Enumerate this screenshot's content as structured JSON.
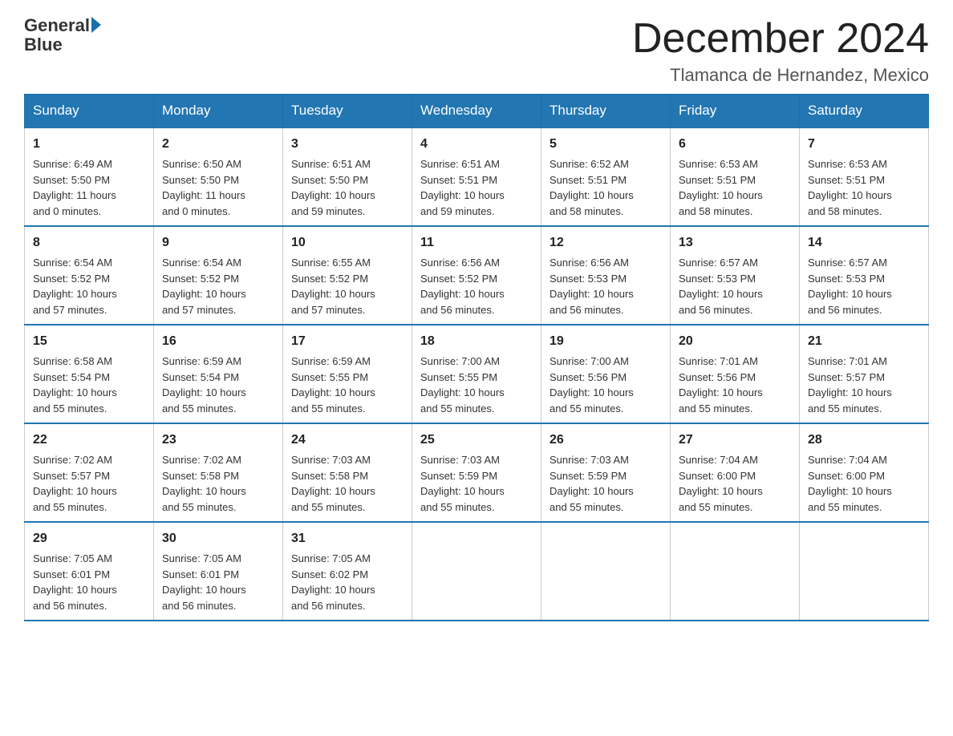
{
  "header": {
    "logo_general": "General",
    "logo_blue": "Blue",
    "month_title": "December 2024",
    "location": "Tlamanca de Hernandez, Mexico"
  },
  "days_of_week": [
    "Sunday",
    "Monday",
    "Tuesday",
    "Wednesday",
    "Thursday",
    "Friday",
    "Saturday"
  ],
  "weeks": [
    [
      {
        "day": "1",
        "sunrise": "6:49 AM",
        "sunset": "5:50 PM",
        "daylight_hours": "11",
        "daylight_minutes": "0"
      },
      {
        "day": "2",
        "sunrise": "6:50 AM",
        "sunset": "5:50 PM",
        "daylight_hours": "11",
        "daylight_minutes": "0"
      },
      {
        "day": "3",
        "sunrise": "6:51 AM",
        "sunset": "5:50 PM",
        "daylight_hours": "10",
        "daylight_minutes": "59"
      },
      {
        "day": "4",
        "sunrise": "6:51 AM",
        "sunset": "5:51 PM",
        "daylight_hours": "10",
        "daylight_minutes": "59"
      },
      {
        "day": "5",
        "sunrise": "6:52 AM",
        "sunset": "5:51 PM",
        "daylight_hours": "10",
        "daylight_minutes": "58"
      },
      {
        "day": "6",
        "sunrise": "6:53 AM",
        "sunset": "5:51 PM",
        "daylight_hours": "10",
        "daylight_minutes": "58"
      },
      {
        "day": "7",
        "sunrise": "6:53 AM",
        "sunset": "5:51 PM",
        "daylight_hours": "10",
        "daylight_minutes": "58"
      }
    ],
    [
      {
        "day": "8",
        "sunrise": "6:54 AM",
        "sunset": "5:52 PM",
        "daylight_hours": "10",
        "daylight_minutes": "57"
      },
      {
        "day": "9",
        "sunrise": "6:54 AM",
        "sunset": "5:52 PM",
        "daylight_hours": "10",
        "daylight_minutes": "57"
      },
      {
        "day": "10",
        "sunrise": "6:55 AM",
        "sunset": "5:52 PM",
        "daylight_hours": "10",
        "daylight_minutes": "57"
      },
      {
        "day": "11",
        "sunrise": "6:56 AM",
        "sunset": "5:52 PM",
        "daylight_hours": "10",
        "daylight_minutes": "56"
      },
      {
        "day": "12",
        "sunrise": "6:56 AM",
        "sunset": "5:53 PM",
        "daylight_hours": "10",
        "daylight_minutes": "56"
      },
      {
        "day": "13",
        "sunrise": "6:57 AM",
        "sunset": "5:53 PM",
        "daylight_hours": "10",
        "daylight_minutes": "56"
      },
      {
        "day": "14",
        "sunrise": "6:57 AM",
        "sunset": "5:53 PM",
        "daylight_hours": "10",
        "daylight_minutes": "56"
      }
    ],
    [
      {
        "day": "15",
        "sunrise": "6:58 AM",
        "sunset": "5:54 PM",
        "daylight_hours": "10",
        "daylight_minutes": "55"
      },
      {
        "day": "16",
        "sunrise": "6:59 AM",
        "sunset": "5:54 PM",
        "daylight_hours": "10",
        "daylight_minutes": "55"
      },
      {
        "day": "17",
        "sunrise": "6:59 AM",
        "sunset": "5:55 PM",
        "daylight_hours": "10",
        "daylight_minutes": "55"
      },
      {
        "day": "18",
        "sunrise": "7:00 AM",
        "sunset": "5:55 PM",
        "daylight_hours": "10",
        "daylight_minutes": "55"
      },
      {
        "day": "19",
        "sunrise": "7:00 AM",
        "sunset": "5:56 PM",
        "daylight_hours": "10",
        "daylight_minutes": "55"
      },
      {
        "day": "20",
        "sunrise": "7:01 AM",
        "sunset": "5:56 PM",
        "daylight_hours": "10",
        "daylight_minutes": "55"
      },
      {
        "day": "21",
        "sunrise": "7:01 AM",
        "sunset": "5:57 PM",
        "daylight_hours": "10",
        "daylight_minutes": "55"
      }
    ],
    [
      {
        "day": "22",
        "sunrise": "7:02 AM",
        "sunset": "5:57 PM",
        "daylight_hours": "10",
        "daylight_minutes": "55"
      },
      {
        "day": "23",
        "sunrise": "7:02 AM",
        "sunset": "5:58 PM",
        "daylight_hours": "10",
        "daylight_minutes": "55"
      },
      {
        "day": "24",
        "sunrise": "7:03 AM",
        "sunset": "5:58 PM",
        "daylight_hours": "10",
        "daylight_minutes": "55"
      },
      {
        "day": "25",
        "sunrise": "7:03 AM",
        "sunset": "5:59 PM",
        "daylight_hours": "10",
        "daylight_minutes": "55"
      },
      {
        "day": "26",
        "sunrise": "7:03 AM",
        "sunset": "5:59 PM",
        "daylight_hours": "10",
        "daylight_minutes": "55"
      },
      {
        "day": "27",
        "sunrise": "7:04 AM",
        "sunset": "6:00 PM",
        "daylight_hours": "10",
        "daylight_minutes": "55"
      },
      {
        "day": "28",
        "sunrise": "7:04 AM",
        "sunset": "6:00 PM",
        "daylight_hours": "10",
        "daylight_minutes": "55"
      }
    ],
    [
      {
        "day": "29",
        "sunrise": "7:05 AM",
        "sunset": "6:01 PM",
        "daylight_hours": "10",
        "daylight_minutes": "56"
      },
      {
        "day": "30",
        "sunrise": "7:05 AM",
        "sunset": "6:01 PM",
        "daylight_hours": "10",
        "daylight_minutes": "56"
      },
      {
        "day": "31",
        "sunrise": "7:05 AM",
        "sunset": "6:02 PM",
        "daylight_hours": "10",
        "daylight_minutes": "56"
      },
      null,
      null,
      null,
      null
    ]
  ],
  "labels": {
    "sunrise": "Sunrise:",
    "sunset": "Sunset:",
    "daylight": "Daylight:"
  }
}
